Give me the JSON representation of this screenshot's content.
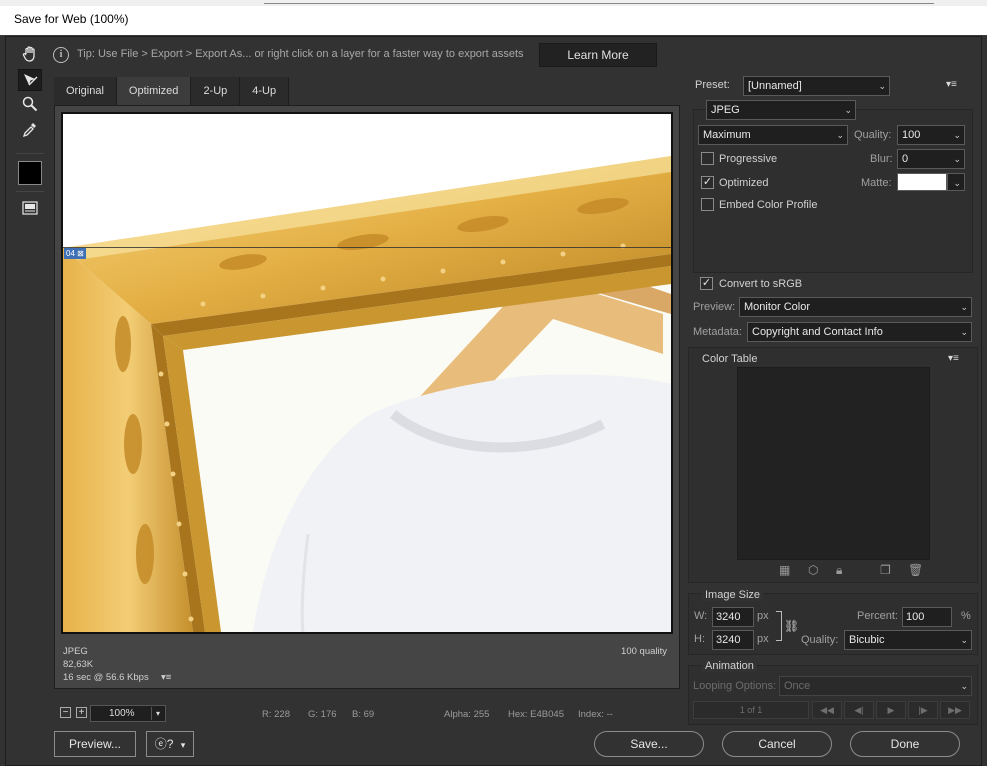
{
  "window": {
    "title": "Save for Web (100%)"
  },
  "tip": {
    "text": "Tip: Use File > Export > Export As... or right click on a layer for a faster way to export assets",
    "learn_more": "Learn More"
  },
  "tools": [
    "hand-tool",
    "slice-select-tool",
    "zoom-tool",
    "eyedropper-tool"
  ],
  "tabs": [
    {
      "label": "Original",
      "active": false
    },
    {
      "label": "Optimized",
      "active": true
    },
    {
      "label": "2-Up",
      "active": false
    },
    {
      "label": "4-Up",
      "active": false
    }
  ],
  "canvas": {
    "slice_badge": "04",
    "format": "JPEG",
    "size": "82,63K",
    "time": "16 sec @ 56.6 Kbps",
    "quality_note": "100 quality"
  },
  "status": {
    "zoom": "100%",
    "r": "R: 228",
    "g": "G: 176",
    "b": "B: 69",
    "alpha": "Alpha: 255",
    "hex": "Hex: E4B045",
    "index": "Index: --"
  },
  "preset": {
    "label": "Preset:",
    "value": "[Unnamed]",
    "format": "JPEG",
    "compression": "Maximum",
    "quality_label": "Quality:",
    "quality": "100",
    "blur_label": "Blur:",
    "blur": "0",
    "matte_label": "Matte:",
    "matte_color": "#ffffff",
    "progressive": "Progressive",
    "optimized": "Optimized",
    "embed_profile": "Embed Color Profile",
    "progressive_checked": false,
    "optimized_checked": true,
    "embed_checked": false
  },
  "convert": {
    "label": "Convert to sRGB",
    "checked": true
  },
  "preview": {
    "label": "Preview:",
    "value": "Monitor Color"
  },
  "metadata": {
    "label": "Metadata:",
    "value": "Copyright and Contact Info"
  },
  "color_table": {
    "title": "Color Table"
  },
  "image_size": {
    "title": "Image Size",
    "w_label": "W:",
    "w": "3240",
    "h_label": "H:",
    "h": "3240",
    "unit": "px",
    "percent_label": "Percent:",
    "percent": "100",
    "percent_unit": "%",
    "quality_label": "Quality:",
    "quality": "Bicubic"
  },
  "animation": {
    "title": "Animation",
    "looping_label": "Looping Options:",
    "looping": "Once",
    "frame": "1 of 1"
  },
  "buttons": {
    "preview": "Preview...",
    "save": "Save...",
    "cancel": "Cancel",
    "done": "Done"
  }
}
